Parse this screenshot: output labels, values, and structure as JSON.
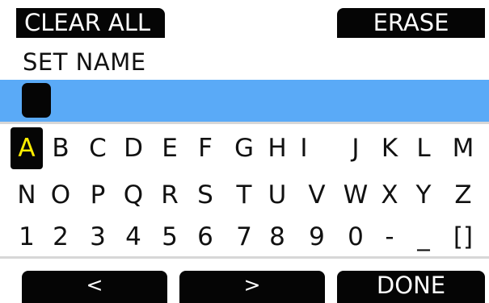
{
  "header": {
    "clear_all_label": "CLEAR ALL",
    "erase_label": "ERASE"
  },
  "title": "SET NAME",
  "name_field": {
    "value": ""
  },
  "keyboard": {
    "rows": [
      [
        "A",
        "B",
        "C",
        "D",
        "E",
        "F",
        "G",
        "H",
        "I",
        "J",
        "K",
        "L",
        "M"
      ],
      [
        "N",
        "O",
        "P",
        "Q",
        "R",
        "S",
        "T",
        "U",
        "V",
        "W",
        "X",
        "Y",
        "Z"
      ],
      [
        "1",
        "2",
        "3",
        "4",
        "5",
        "6",
        "7",
        "8",
        "9",
        "0",
        "-",
        "_",
        "[]"
      ]
    ],
    "selected": "A"
  },
  "footer": {
    "prev_label": "<",
    "next_label": ">",
    "done_label": "DONE"
  },
  "colors": {
    "name_bar": "#5aaaf7",
    "selected_key_text": "#ffee00",
    "button_bg": "#050505"
  }
}
